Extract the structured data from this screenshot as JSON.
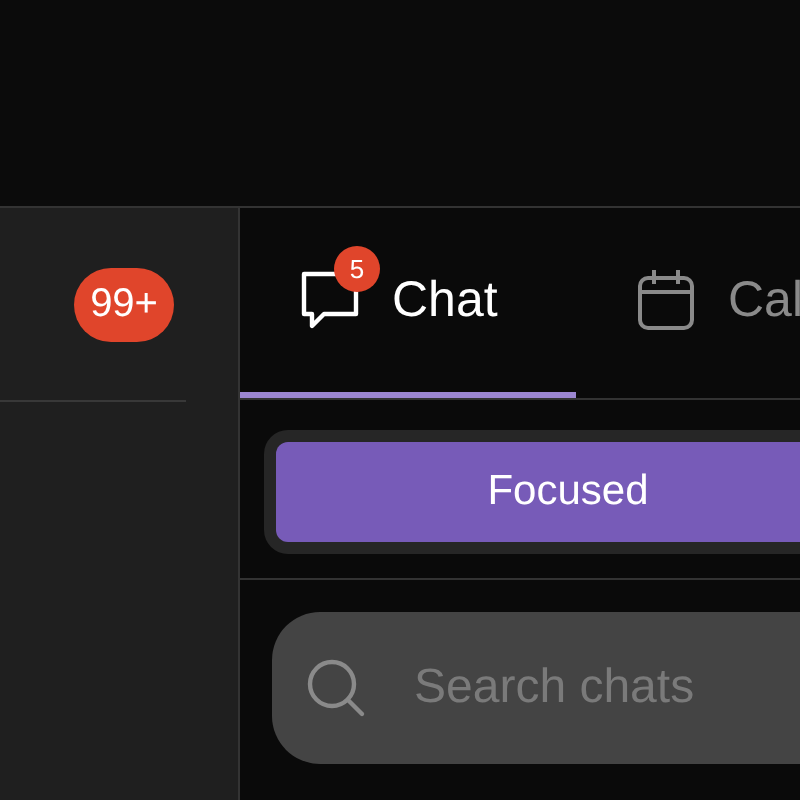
{
  "sidebar": {
    "badge": "99+"
  },
  "tabs": [
    {
      "kind": "chat",
      "label": "Chat",
      "selected": true,
      "badge": "5"
    },
    {
      "kind": "calendar",
      "label": "Cal",
      "selected": false
    }
  ],
  "segments": [
    {
      "label": "Focused",
      "selected": true
    }
  ],
  "search": {
    "placeholder": "Search chats"
  }
}
